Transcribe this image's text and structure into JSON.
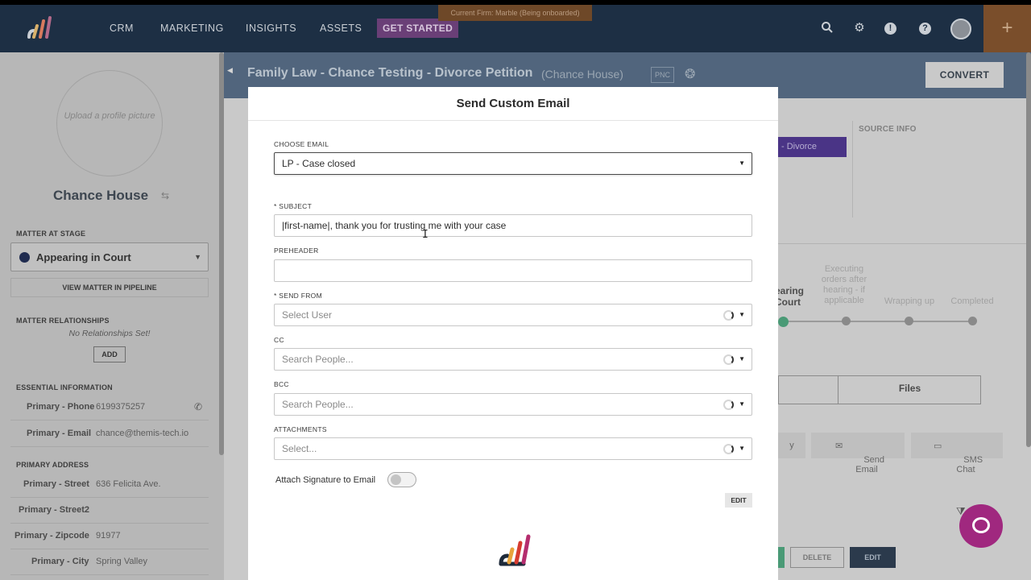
{
  "nav": {
    "items": [
      "CRM",
      "MARKETING",
      "INSIGHTS",
      "ASSETS"
    ],
    "get_started": "GET STARTED",
    "firm_banner": "Current Firm: Marble (Being onboarded)",
    "plus": "+"
  },
  "sidebar": {
    "upload_text": "Upload a profile picture",
    "contact_name": "Chance House",
    "matter_stage_heading": "MATTER AT STAGE",
    "stage_value": "Appearing in Court",
    "view_pipeline": "VIEW MATTER IN PIPELINE",
    "relationships_heading": "MATTER RELATIONSHIPS",
    "no_relationships": "No Relationships Set!",
    "add_label": "ADD",
    "essential_heading": "ESSENTIAL INFORMATION",
    "phone_label": "Primary - Phone",
    "phone_value": "6199375257",
    "email_label": "Primary - Email",
    "email_value": "chance@themis-tech.io",
    "address_heading": "PRIMARY ADDRESS",
    "street_label": "Primary - Street",
    "street_value": "636 Felicita Ave.",
    "street2_label": "Primary - Street2",
    "zip_label": "Primary - Zipcode",
    "zip_value": "91977",
    "city_label": "Primary - City",
    "city_value": "Spring Valley"
  },
  "matter": {
    "title": "Family Law - Chance Testing - Divorce Petition",
    "contact": "(Chance House)",
    "badge": "PNC",
    "convert": "CONVERT",
    "source_info": "SOURCE INFO",
    "chip": "- Divorce",
    "stages": {
      "current": "earing\nCourt",
      "executing": "Executing\norders after\nhearing - if\napplicable",
      "wrapping": "Wrapping up",
      "completed": "Completed"
    },
    "files_tab": "Files",
    "send_email": "Send\nEmail",
    "sms_chat": "SMS\nChat",
    "partial_btn": "y",
    "delete": "DELETE",
    "edit": "EDIT"
  },
  "modal": {
    "title": "Send Custom Email",
    "choose_email_label": "CHOOSE EMAIL",
    "choose_email_value": "LP - Case closed",
    "subject_label": "* SUBJECT",
    "subject_value": "|first-name|, thank you for trusting me with your case",
    "preheader_label": "PREHEADER",
    "preheader_value": "",
    "send_from_label": "* SEND FROM",
    "send_from_placeholder": "Select User",
    "cc_label": "CC",
    "cc_placeholder": "Search People...",
    "bcc_label": "BCC",
    "bcc_placeholder": "Search People...",
    "attachments_label": "ATTACHMENTS",
    "attachments_placeholder": "Select...",
    "signature_label": "Attach Signature to Email",
    "signature_enabled": false,
    "edit_label": "EDIT"
  },
  "colors": {
    "nav_bg": "#1d2f44",
    "accent_purple": "#a0287f",
    "brand_orange": "#e8a33b",
    "brand_red": "#d63b2f",
    "brand_dark": "#1e2a3a"
  }
}
